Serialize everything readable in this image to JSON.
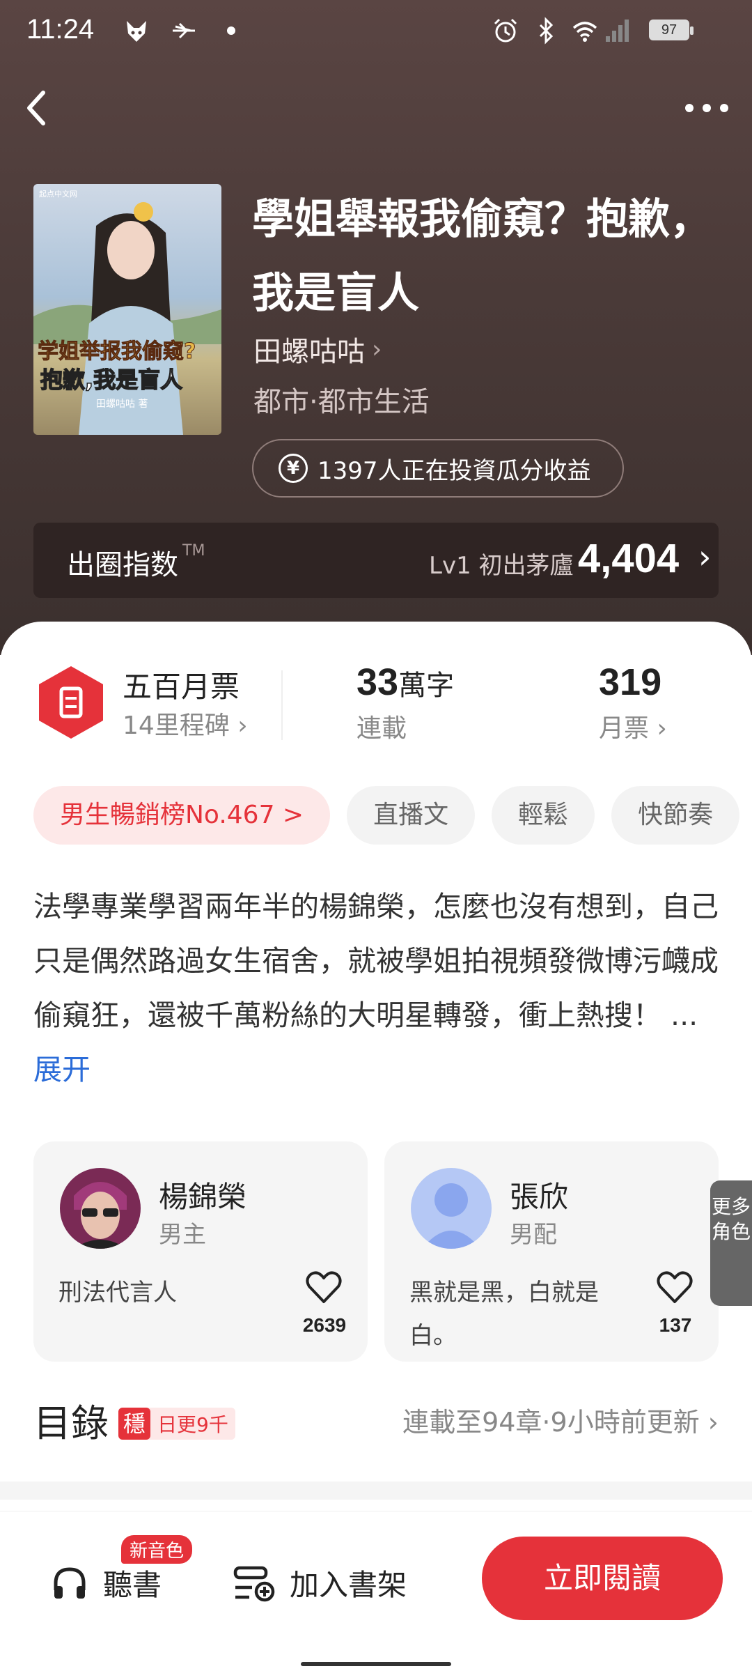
{
  "status_bar": {
    "time": "11:24",
    "battery": "97"
  },
  "book": {
    "title": "學姐舉報我偷窺？抱歉，我是盲人",
    "author": "田螺咕咕",
    "genre": "都市·都市生活",
    "investors": "1397人正在投資瓜分收益",
    "cover": {
      "publisher": "起点中文网",
      "title_line1": "学姐举报我偷窥?",
      "title_line2": "抱歉,我是盲人",
      "author_text": "田螺咕咕 著"
    }
  },
  "circle_index": {
    "label": "出圈指数",
    "tm": "TM",
    "level": "Lv1 初出茅廬",
    "score": "4,404"
  },
  "stats": {
    "milestone_title": "五百月票",
    "milestone_sub": "14里程碑",
    "words": "33",
    "words_unit": "萬字",
    "status": "連載",
    "monthly_votes": "319",
    "monthly_votes_label": "月票"
  },
  "tags": [
    "男生暢銷榜No.467 >",
    "直播文",
    "輕鬆",
    "快節奏"
  ],
  "description": {
    "text": "法學專業學習兩年半的楊錦榮，怎麼也沒有想到，自己只是偶然路過女生宿舍，就被學姐拍視頻發微博污衊成偷窺狂，還被千萬粉絲的大明星轉發，衝上熱搜！",
    "ellipsis": "...",
    "expand": "展开"
  },
  "characters": [
    {
      "name": "楊錦榮",
      "role": "男主",
      "desc": "刑法代言人",
      "likes": "2639"
    },
    {
      "name": "張欣",
      "role": "男配",
      "desc": "黑就是黑，白就是白。",
      "likes": "137"
    }
  ],
  "more_roles": "更多角色",
  "toc": {
    "title": "目錄",
    "badge_icon": "穩",
    "badge_text": "日更9千",
    "update": "連載至94章·9小時前更新"
  },
  "bottom": {
    "listen": "聽書",
    "new_voice": "新音色",
    "add_shelf": "加入書架",
    "read_now": "立即閱讀"
  },
  "colors": {
    "accent": "#e5323a",
    "link": "#2b6cd8",
    "hero_bg": "#4a3a38"
  }
}
